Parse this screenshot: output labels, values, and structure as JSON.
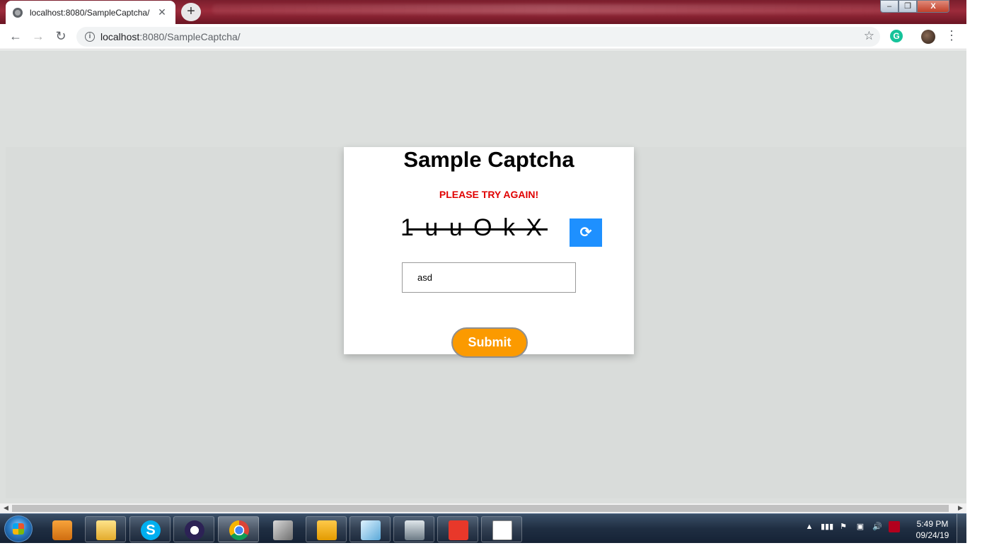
{
  "browser": {
    "tab_title": "localhost:8080/SampleCaptcha/",
    "tab_close": "✕",
    "new_tab": "+",
    "url_host": "localhost",
    "url_rest": ":8080/SampleCaptcha/",
    "grammarly": "G",
    "window_controls": {
      "minimize": "–",
      "maximize": "❐",
      "close": "X"
    },
    "nav": {
      "back": "←",
      "forward": "→",
      "reload": "↻",
      "info": "i",
      "star": "☆",
      "menu": "⋮"
    }
  },
  "page": {
    "title": "Sample Captcha",
    "error": "PLEASE TRY AGAIN!",
    "captcha_text": "1uuOkX",
    "captcha_display": "1 u u O k X",
    "refresh_symbol": "⟳",
    "input_value": "asd",
    "submit_label": "Submit"
  },
  "taskbar": {
    "apps": [
      "media-player",
      "file-explorer",
      "skype",
      "eclipse",
      "chrome",
      "tools",
      "outlook",
      "blue-app",
      "remote-desktop",
      "anydesk",
      "document"
    ],
    "active_app": "chrome",
    "tray": {
      "expand": "▲",
      "signal": "▮▮▮",
      "flag": "⚑",
      "device": "▣",
      "volume": "🔊"
    },
    "clock_time": "5:49 PM",
    "clock_date": "09/24/19",
    "skype_letter": "S"
  },
  "colors": {
    "accent_blue": "#1e90ff",
    "submit_orange": "#fb9a00",
    "error_red": "#e00000",
    "page_bg": "#dcdfdd"
  },
  "icons": {
    "tab_favicon": "globe-icon",
    "refresh": "refresh-icon",
    "address_info": "info-icon",
    "bookmark": "star-icon"
  }
}
